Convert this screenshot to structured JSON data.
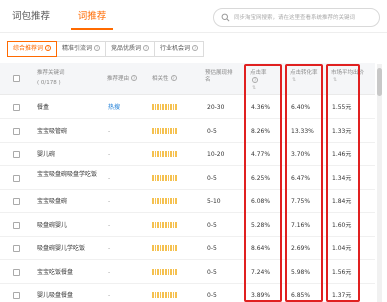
{
  "tabs": [
    {
      "label": "词包推荐"
    },
    {
      "label": "词推荐"
    }
  ],
  "search": {
    "placeholder": "同步淘宝网搜索，请在这里查看系统推荐的关键词"
  },
  "subtabs": [
    {
      "label": "综合推荐词"
    },
    {
      "label": "精准引流词"
    },
    {
      "label": "竞品优质词"
    },
    {
      "label": "行业机会词"
    }
  ],
  "table": {
    "headers": {
      "keyword": "推荐关键词",
      "count": "( 0/178 )",
      "reason": "推荐理由",
      "relevance": "相关性",
      "rank": "预估展现排名",
      "ctr": "点击率",
      "cvr": "点击转化率",
      "cpc": "市场平均出价"
    },
    "rows": [
      {
        "keyword": "餐盒",
        "reason": "热搜",
        "relevance": 5,
        "rank": "20-30",
        "ctr": "4.36%",
        "cvr": "6.40%",
        "cpc": "1.55元"
      },
      {
        "keyword": "宝宝吸管碗",
        "reason": "-",
        "relevance": 5,
        "rank": "0-5",
        "ctr": "8.26%",
        "cvr": "13.33%",
        "cpc": "1.33元"
      },
      {
        "keyword": "婴儿碗",
        "reason": "-",
        "relevance": 5,
        "rank": "10-20",
        "ctr": "4.77%",
        "cvr": "3.70%",
        "cpc": "1.46元"
      },
      {
        "keyword": "宝宝吸盘碗吸盘学吃饭",
        "reason": "-",
        "relevance": 5,
        "rank": "0-5",
        "ctr": "6.25%",
        "cvr": "6.47%",
        "cpc": "1.34元"
      },
      {
        "keyword": "宝宝吸盘碗",
        "reason": "-",
        "relevance": 5,
        "rank": "5-10",
        "ctr": "6.08%",
        "cvr": "7.75%",
        "cpc": "1.84元"
      },
      {
        "keyword": "吸盘碗婴儿",
        "reason": "-",
        "relevance": 5,
        "rank": "0-5",
        "ctr": "5.28%",
        "cvr": "7.16%",
        "cpc": "1.60元"
      },
      {
        "keyword": "吸盘碗婴儿学吃饭",
        "reason": "-",
        "relevance": 5,
        "rank": "0-5",
        "ctr": "8.64%",
        "cvr": "2.69%",
        "cpc": "1.04元"
      },
      {
        "keyword": "宝宝吃饭餐盘",
        "reason": "-",
        "relevance": 5,
        "rank": "0-5",
        "ctr": "7.24%",
        "cvr": "5.98%",
        "cpc": "1.56元"
      },
      {
        "keyword": "婴儿吸盘餐盘",
        "reason": "-",
        "relevance": 5,
        "rank": "0-5",
        "ctr": "3.89%",
        "cvr": "6.85%",
        "cpc": "1.37元"
      }
    ]
  },
  "colors": {
    "accent": "#ff6a00",
    "link": "#1a7cd6",
    "highlight_box": "#e02020",
    "bar": "#f5c150"
  }
}
